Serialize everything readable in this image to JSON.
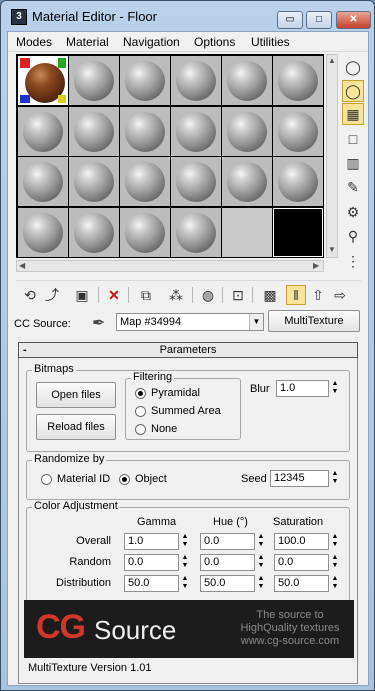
{
  "window": {
    "title": "Material Editor - Floor",
    "minimize_icon": "minimize-icon",
    "restore_icon": "restore-icon",
    "close_icon": "close-icon",
    "minimize_label": "▭",
    "restore_label": "□",
    "close_label": "✕"
  },
  "menu": [
    "Modes",
    "Material",
    "Navigation",
    "Options",
    "Utilities"
  ],
  "slots": {
    "rows": 4,
    "cols": 6,
    "active_slot": 0,
    "black_slot": 23,
    "empty_slot": 22
  },
  "side_tools": [
    "sample-sphere-icon",
    "backlight-icon",
    "checker-background-icon",
    "sample-uv-tiling-icon",
    "video-color-check-icon",
    "make-preview-icon",
    "options-icon",
    "select-by-material-icon",
    "material-map-navigator-icon"
  ],
  "toolbar": [
    "get-material-icon",
    "put-to-scene-icon",
    "assign-material-icon",
    "reset-map-icon",
    "make-unique-icon",
    "copy-material-icon",
    "put-to-library-icon",
    "material-id-channel-icon",
    "show-shaded-icon",
    "show-end-result-icon",
    "go-to-parent-icon",
    "go-forward-icon",
    "go-sibling-icon"
  ],
  "cc_source": {
    "label": "CC Source:",
    "map_value": "Map #34994",
    "type_button": "MultiTexture"
  },
  "rollout": {
    "title": "Parameters",
    "collapse": "-"
  },
  "bitmaps": {
    "group_label": "Bitmaps",
    "open_files": "Open files",
    "reload_files": "Reload files"
  },
  "filtering": {
    "group_label": "Filtering",
    "options": [
      "Pyramidal",
      "Summed Area",
      "None"
    ],
    "selected": 0
  },
  "blur": {
    "label": "Blur",
    "value": "1.0"
  },
  "randomize": {
    "group_label": "Randomize by",
    "material_id": "Material ID",
    "object": "Object",
    "selected": "object",
    "seed_label": "Seed",
    "seed_value": "12345"
  },
  "color_adjustment": {
    "group_label": "Color Adjustment",
    "columns": [
      "Gamma",
      "Hue (°)",
      "Saturation"
    ],
    "rows": [
      {
        "label": "Overall",
        "values": [
          "1.0",
          "0.0",
          "100.0"
        ]
      },
      {
        "label": "Random",
        "values": [
          "0.0",
          "0.0",
          "0.0"
        ]
      },
      {
        "label": "Distribution",
        "values": [
          "50.0",
          "50.0",
          "50.0"
        ]
      }
    ]
  },
  "banner": {
    "brand_cg": "CG",
    "brand_source": "Source",
    "tagline_1": "The source to",
    "tagline_2": "HighQuality textures",
    "url": "www.cg-source.com"
  },
  "version": "MultiTexture Version 1.01",
  "colors": {
    "accent_active": "#f7e39a",
    "brand_red": "#d4372a",
    "banner_bg": "#1c1c1c"
  }
}
